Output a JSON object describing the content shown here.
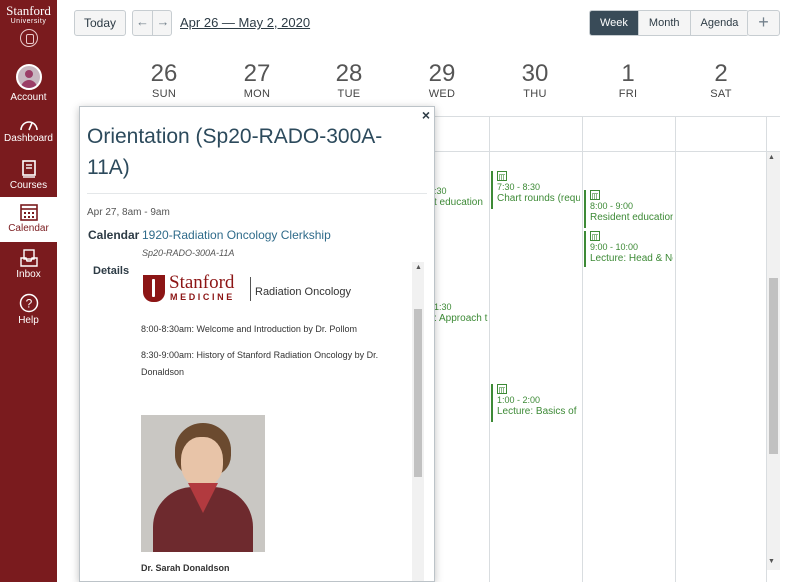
{
  "nav": {
    "logo_word": "Stanford",
    "logo_sub": "University",
    "items": [
      {
        "label": "Account"
      },
      {
        "label": "Dashboard"
      },
      {
        "label": "Courses"
      },
      {
        "label": "Calendar"
      },
      {
        "label": "Inbox"
      },
      {
        "label": "Help"
      }
    ],
    "brand_color": "#7a1b1e"
  },
  "header": {
    "today_label": "Today",
    "prev_arrow": "←",
    "next_arrow": "→",
    "date_range": "Apr 26 — May 2, 2020",
    "views": [
      "Week",
      "Month",
      "Agenda"
    ],
    "active_view": "Week",
    "add_label": "+"
  },
  "week": {
    "days": [
      {
        "num": "26",
        "name": "SUN"
      },
      {
        "num": "27",
        "name": "MON"
      },
      {
        "num": "28",
        "name": "TUE"
      },
      {
        "num": "29",
        "name": "WED"
      },
      {
        "num": "30",
        "name": "THU"
      },
      {
        "num": "1",
        "name": "FRI"
      },
      {
        "num": "2",
        "name": "SAT"
      }
    ]
  },
  "events": {
    "wed1_time": ":30",
    "wed1_name": "t education",
    "wed2_time": "1:30",
    "wed2_name": ": Approach t",
    "thu1_time": "7:30 - 8:30",
    "thu1_name": "Chart rounds (requi",
    "thu2_time": "1:00 - 2:00",
    "thu2_name": "Lecture: Basics of Pr",
    "fri1_time": "8:00 - 9:00",
    "fri1_name": "Resident education",
    "fri2_time": "9:00 - 10:00",
    "fri2_name": "Lecture: Head & Ne",
    "event_color": "#3d8a36"
  },
  "popover": {
    "close_label": "×",
    "title": "Orientation (Sp20-RADO-300A-11A)",
    "date": "Apr 27, 8am - 9am",
    "calendar_label": "Calendar",
    "calendar_name": "1920-Radiation Oncology Clerkship",
    "calendar_code": "Sp20-RADO-300A-11A",
    "details_label": "Details",
    "logo_stanford": "Stanford",
    "logo_medicine": "MEDICINE",
    "logo_dept": "Radiation Oncology",
    "line1": "8:00-8:30am: Welcome and Introduction by Dr. Pollom",
    "line2": "8:30-9:00am: History of Stanford Radiation Oncology by Dr. Donaldson",
    "caption": "Dr. Sarah Donaldson"
  }
}
